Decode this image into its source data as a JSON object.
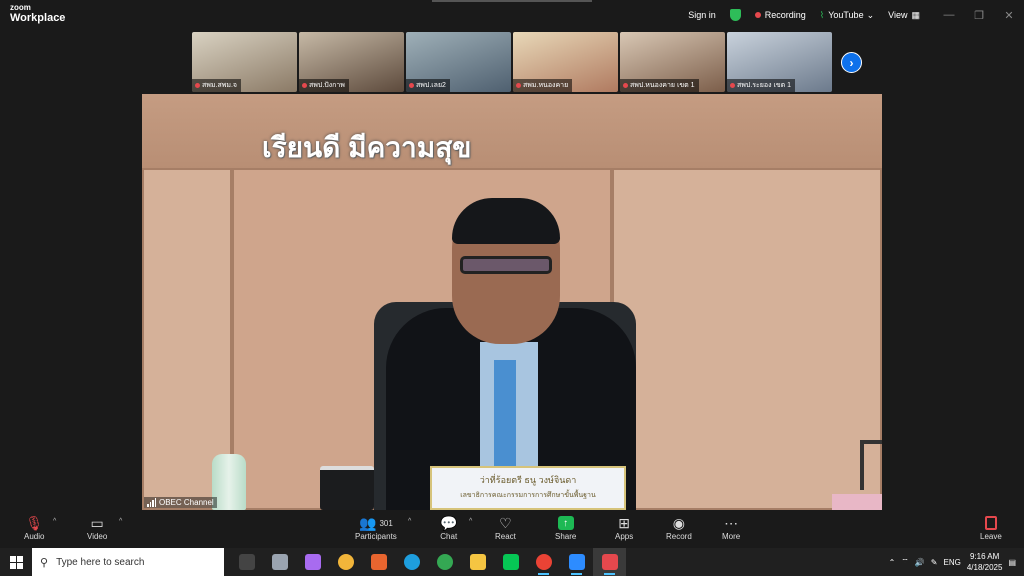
{
  "app": {
    "brand_small": "zoom",
    "brand_large": "Workplace"
  },
  "topbar": {
    "sign_in": "Sign in",
    "recording": "Recording",
    "youtube": "YouTube",
    "view": "View",
    "shield_color": "#2ebd59",
    "record_color": "#e5484d"
  },
  "gallery": {
    "participants": [
      {
        "name": "สพม.สพม.จ",
        "colors": [
          "#d9d2c2",
          "#8b7a66"
        ]
      },
      {
        "name": "สพป.ปังกาพ",
        "colors": [
          "#c6b9a6",
          "#5d4a3c"
        ]
      },
      {
        "name": "สพป.เลย2",
        "colors": [
          "#9fb0b8",
          "#4f6070"
        ]
      },
      {
        "name": "สพม.หนองคาย",
        "colors": [
          "#e8d8b8",
          "#b07a60"
        ]
      },
      {
        "name": "สพป.หนองคาย เขต 1",
        "colors": [
          "#d8c7b4",
          "#7c5e4a"
        ]
      },
      {
        "name": "สพป.ระยอง เขต 1",
        "colors": [
          "#c9d2dc",
          "#6c7a8c"
        ]
      }
    ],
    "next_icon": "chevron-right-icon"
  },
  "video": {
    "banner": "เรียนดี มีความสุข",
    "nameplate_line1": "ว่าที่ร้อยตรี ธนู  วงษ์จินดา",
    "nameplate_line2": "เลขาธิการคณะกรรมการการศึกษาขั้นพื้นฐาน",
    "channel": "OBEC Channel"
  },
  "controls": {
    "audio": "Audio",
    "video": "Video",
    "participants": "Participants",
    "participants_count": "301",
    "chat": "Chat",
    "react": "React",
    "share": "Share",
    "apps": "Apps",
    "record": "Record",
    "more": "More",
    "leave": "Leave"
  },
  "taskbar": {
    "search_placeholder": "Type here to search",
    "language": "ENG",
    "time": "9:16 AM",
    "date": "4/18/2025",
    "apps": [
      {
        "name": "task-view-icon",
        "color": "#444444"
      },
      {
        "name": "file-manager-icon",
        "color": "#9aa4b0"
      },
      {
        "name": "copilot-icon",
        "color": "#a86bf0"
      },
      {
        "name": "chrome-icon",
        "color": "#f2b53a"
      },
      {
        "name": "rss-icon",
        "color": "#e8652f"
      },
      {
        "name": "edge-icon",
        "color": "#1e9ede"
      },
      {
        "name": "chrome-icon-2",
        "color": "#34a853"
      },
      {
        "name": "folder-icon",
        "color": "#f5c542"
      },
      {
        "name": "line-icon",
        "color": "#06c755"
      },
      {
        "name": "chrome-icon-3",
        "color": "#ea4335"
      },
      {
        "name": "zoom-icon",
        "color": "#2d8cff"
      },
      {
        "name": "zoom-mic-icon",
        "color": "#e5484d"
      }
    ]
  }
}
